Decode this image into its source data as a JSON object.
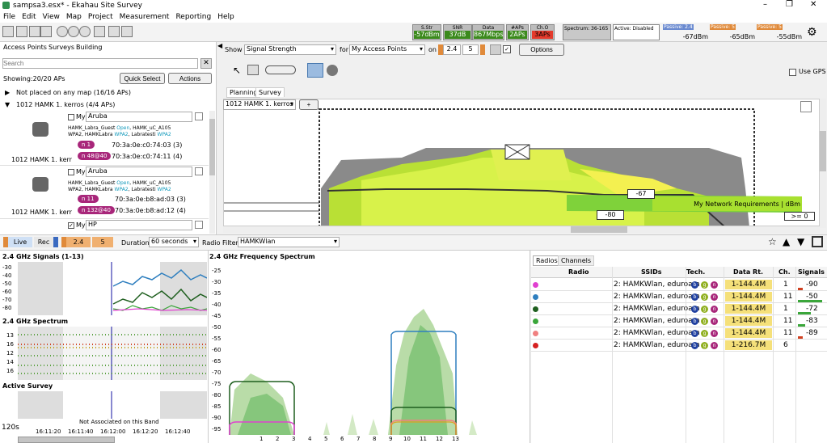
{
  "window": {
    "title": "sampsa3.esx* - Ekahau Site Survey"
  },
  "menu": [
    "File",
    "Edit",
    "View",
    "Map",
    "Project",
    "Measurement",
    "Reporting",
    "Help"
  ],
  "stats": [
    {
      "label": "S.Str",
      "value": "-57dBm"
    },
    {
      "label": "SNR",
      "value": "37dB"
    },
    {
      "label": "Data",
      "value": "867Mbps"
    },
    {
      "label": "#APs",
      "value": "2APs"
    },
    {
      "label": "Ch.O",
      "value": "3APs"
    }
  ],
  "spectrum_label": "Spectrum: 36-165",
  "active_label": "Active: Disabled",
  "passive": [
    {
      "label": "Passive: 2.4",
      "value": "-67dBm"
    },
    {
      "label": "Passive: 5",
      "value": "-65dBm"
    },
    {
      "label": "Passive: 5",
      "value": "-55dBm"
    }
  ],
  "left": {
    "tabs": [
      "Access Points",
      "Surveys",
      "Building"
    ],
    "search_placeholder": "Search",
    "showing": "Showing:20/20 APs",
    "quick_select": "Quick Select",
    "actions": "Actions",
    "group_not_placed": "Not placed on any map (16/16 APs)",
    "group_map": "1012 HAMK 1. kerros (4/4 APs)",
    "aps": [
      {
        "map": "1012 HAMK 1. kerr",
        "my": "My",
        "vendor": "Aruba",
        "ssid1": "HAMK_Labra_Guest",
        "ssid1_sec": "Open",
        "ssid2": "HAMK_uC_A105",
        "ssid3": "WPA2, HAMKLabra",
        "ssid3_sec": "WPA2",
        "ssid4": "Labratesti",
        "ssid4_sec": "WPA2",
        "chip1": "n 1",
        "mac1": "70:3a:0e:c0:74:03 (3)",
        "chip2": "n 48@40",
        "mac2": "70:3a:0e:c0:74:11 (4)"
      },
      {
        "map": "1012 HAMK 1. kerr",
        "my": "My",
        "vendor": "Aruba",
        "ssid1": "HAMK_Labra_Guest",
        "ssid1_sec": "Open",
        "ssid2": "HAMK_uC_A105",
        "ssid3": "WPA2, HAMKLabra",
        "ssid3_sec": "WPA2",
        "ssid4": "Labratesti",
        "ssid4_sec": "WPA2",
        "chip1": "n 11",
        "mac1": "70:3a:0e:b8:ad:03 (3)",
        "chip2": "n 132@40",
        "mac2": "70:3a:0e:b8:ad:12 (4)"
      },
      {
        "my": "My",
        "vendor": "HP"
      }
    ]
  },
  "view": {
    "show_label": "Show",
    "show_value": "Signal Strength",
    "for_label": "for",
    "for_value": "My Access Points",
    "on_label": "on",
    "band1": "2.4",
    "band2": "5",
    "options": "Options",
    "tabs": [
      "Planning",
      "Survey"
    ],
    "map_select": "1012 HAMK 1. kerros",
    "add": "+",
    "use_gps": "Use GPS",
    "readout1": "-67",
    "readout2": "-80",
    "legend": "My Network Requirements | dBm",
    "legend_val": ">= 0"
  },
  "bottom": {
    "live": "Live",
    "rec": "Rec",
    "b24": "2.4",
    "b5": "5",
    "duration_label": "Duration",
    "duration_value": "60 seconds",
    "radio_filter_label": "Radio Filter",
    "radio_filter_value": "HAMKWlan"
  },
  "panels": {
    "signals_title": "2.4 GHz Signals (1-13)",
    "signals_ticks": [
      "-30",
      "-40",
      "-50",
      "-60",
      "-70",
      "-80"
    ],
    "spectrum_title": "2.4 GHz Spectrum",
    "spectrum_ticks": [
      "13",
      "16",
      "12",
      "14",
      "16"
    ],
    "active_title": "Active Survey",
    "not_assoc": "Not Associated on this Band",
    "time_label": "120s",
    "times": [
      "16:11:20",
      "16:11:40",
      "16:12:00",
      "16:12:20",
      "16:12:40"
    ],
    "freq_title": "2.4 GHz Frequency Spectrum",
    "freq_yticks": [
      "-25",
      "-30",
      "-35",
      "-40",
      "-45",
      "-50",
      "-55",
      "-60",
      "-65",
      "-70",
      "-75",
      "-80",
      "-85",
      "-90",
      "-95"
    ],
    "freq_xticks": [
      "1",
      "2",
      "3",
      "4",
      "5",
      "6",
      "7",
      "8",
      "9",
      "10",
      "11",
      "12",
      "13"
    ]
  },
  "table": {
    "tabs": [
      "Radios",
      "Channels"
    ],
    "headers": [
      "Radio",
      "SSIDs",
      "Tech.",
      "Data Rt.",
      "Ch.",
      "Signals"
    ],
    "rows": [
      {
        "color": "#e040d0",
        "ssid": "2: HAMKWlan, eduroam",
        "rate": "1-144.4M",
        "ch": "1",
        "sig": "-90"
      },
      {
        "color": "#2f7fbf",
        "ssid": "2: HAMKWlan, eduroam",
        "rate": "1-144.4M",
        "ch": "11",
        "sig": "-50"
      },
      {
        "color": "#1f5f1f",
        "ssid": "2: HAMKWlan, eduroam",
        "rate": "1-144.4M",
        "ch": "1",
        "sig": "-72"
      },
      {
        "color": "#3aa63a",
        "ssid": "2: HAMKWlan, eduroam",
        "rate": "1-144.4M",
        "ch": "11",
        "sig": "-83"
      },
      {
        "color": "#f08080",
        "ssid": "2: HAMKWlan, eduroam",
        "rate": "1-144.4M",
        "ch": "11",
        "sig": "-89"
      },
      {
        "color": "#d62020",
        "ssid": "2: HAMKWlan, eduroam",
        "rate": "1-216.7M",
        "ch": "6",
        "sig": ""
      }
    ]
  }
}
